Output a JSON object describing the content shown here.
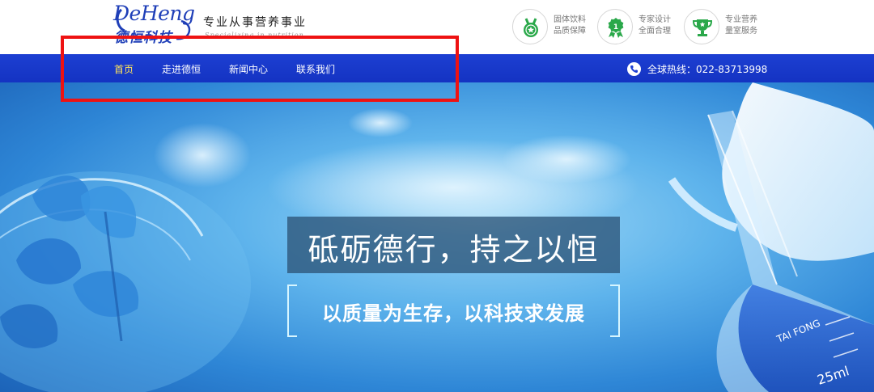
{
  "header": {
    "logo_en": "DeHeng",
    "logo_cn": "德恒科技",
    "slogan": "专业从事营养事业",
    "slogan_sub": "Specializing in nutrition",
    "badges": [
      {
        "icon": "medal-icon",
        "line1": "固体饮料",
        "line2": "品质保障"
      },
      {
        "icon": "award-icon",
        "line1": "专家设计",
        "line2": "全面合理"
      },
      {
        "icon": "trophy-icon",
        "line1": "专业营养",
        "line2": "量室服务"
      }
    ]
  },
  "nav": {
    "items": [
      {
        "label": "首页",
        "active": true
      },
      {
        "label": "走进德恒",
        "active": false
      },
      {
        "label": "新闻中心",
        "active": false
      },
      {
        "label": "联系我们",
        "active": false
      }
    ],
    "hotline": "全球热线：022-83713998"
  },
  "banner": {
    "tagline": "砥砺德行，持之以恒",
    "subline": "以质量为生存，以科技求发展",
    "beaker_mark": "TAI FONG",
    "beaker_volume": "25ml"
  },
  "colors": {
    "nav_bg": "#1d3fd2",
    "nav_active": "#ffe35a",
    "brand": "#1f3fb8",
    "badge_green": "#2aa84a",
    "highlight": "#ee1212"
  }
}
